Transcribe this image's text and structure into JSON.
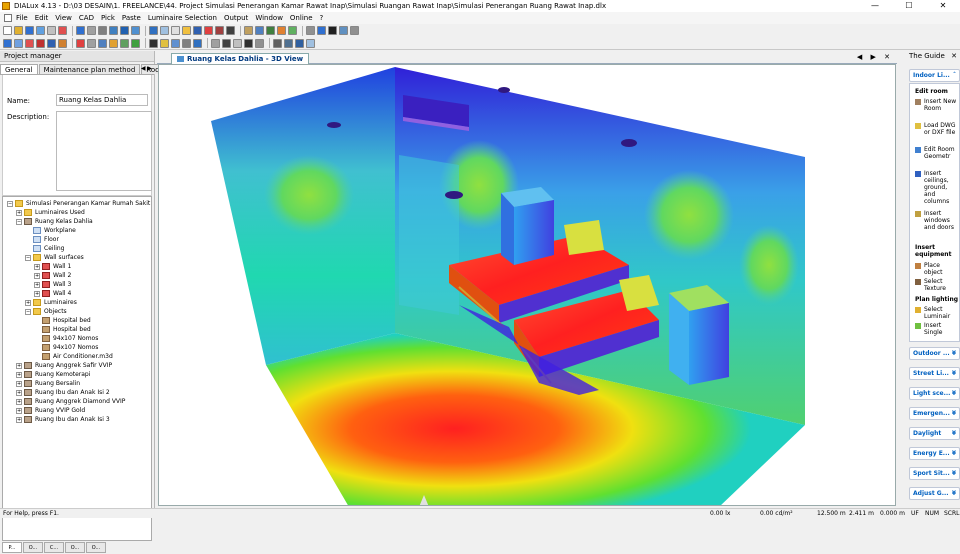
{
  "window": {
    "title": "DIALux 4.13 - D:\\03 DESAIN\\1. FREELANCE\\44. Project Simulasi Penerangan Kamar  Rawat Inap\\Simulasi Ruangan Rawat Inap\\Simulasi Penerangan Ruang Rawat Inap.dlx",
    "min": "—",
    "max": "☐",
    "close": "✕"
  },
  "menu": [
    "File",
    "Edit",
    "View",
    "CAD",
    "Pick",
    "Paste",
    "Luminaire Selection",
    "Output",
    "Window",
    "Online",
    "?"
  ],
  "project_manager": {
    "header": "Project manager",
    "tabs": [
      "General",
      "Maintenance plan method",
      "Roor"
    ],
    "tab_nav": "◀ ▶",
    "name_label": "Name:",
    "name_value": "Ruang Kelas Dahlia",
    "desc_label": "Description:"
  },
  "tree": [
    {
      "label": "Simulasi Penerangan Kamar Rumah Sakit",
      "level": 0,
      "exp": "−",
      "icon": "folder"
    },
    {
      "label": "Luminaires Used",
      "level": 1,
      "exp": "+",
      "icon": "folder"
    },
    {
      "label": "Ruang Kelas Dahlia",
      "level": 1,
      "exp": "−",
      "icon": "room"
    },
    {
      "label": "Workplane",
      "level": 2,
      "exp": "",
      "icon": "surf"
    },
    {
      "label": "Floor",
      "level": 2,
      "exp": "",
      "icon": "surf"
    },
    {
      "label": "Ceiling",
      "level": 2,
      "exp": "",
      "icon": "surf"
    },
    {
      "label": "Wall surfaces",
      "level": 2,
      "exp": "−",
      "icon": "folder"
    },
    {
      "label": "Wall 1",
      "level": 3,
      "exp": "+",
      "icon": "wall"
    },
    {
      "label": "Wall 2",
      "level": 3,
      "exp": "+",
      "icon": "wall"
    },
    {
      "label": "Wall 3",
      "level": 3,
      "exp": "+",
      "icon": "wall"
    },
    {
      "label": "Wall 4",
      "level": 3,
      "exp": "+",
      "icon": "wall"
    },
    {
      "label": "Luminaires",
      "level": 2,
      "exp": "+",
      "icon": "folder"
    },
    {
      "label": "Objects",
      "level": 2,
      "exp": "−",
      "icon": "folder"
    },
    {
      "label": "Hospital bed",
      "level": 3,
      "exp": "",
      "icon": "obj"
    },
    {
      "label": "Hospital bed",
      "level": 3,
      "exp": "",
      "icon": "obj"
    },
    {
      "label": "94x107 Nomos",
      "level": 3,
      "exp": "",
      "icon": "obj"
    },
    {
      "label": "94x107 Nomos",
      "level": 3,
      "exp": "",
      "icon": "obj"
    },
    {
      "label": "Air Conditioner.m3d",
      "level": 3,
      "exp": "",
      "icon": "obj"
    },
    {
      "label": "Ruang Anggrek Safir VVIP",
      "level": 1,
      "exp": "+",
      "icon": "room"
    },
    {
      "label": "Ruang Kemoterapi",
      "level": 1,
      "exp": "+",
      "icon": "room"
    },
    {
      "label": "Ruang Bersalin",
      "level": 1,
      "exp": "+",
      "icon": "room"
    },
    {
      "label": "Ruang Ibu dan Anak Isi 2",
      "level": 1,
      "exp": "+",
      "icon": "room"
    },
    {
      "label": "Ruang Anggrek Diamond VVIP",
      "level": 1,
      "exp": "+",
      "icon": "room"
    },
    {
      "label": "Ruang VVIP Gold",
      "level": 1,
      "exp": "+",
      "icon": "room"
    },
    {
      "label": "Ruang Ibu dan Anak Isi 3",
      "level": 1,
      "exp": "+",
      "icon": "room"
    }
  ],
  "bottom_tabs": [
    "P...",
    "O...",
    "C...",
    "O...",
    "O..."
  ],
  "view": {
    "tab": "Ruang Kelas Dahlia - 3D View",
    "controls": "◀ ▶ ✕"
  },
  "guide": {
    "title": "The Guide",
    "pin": "✕",
    "top_section": "Indoor Li...",
    "groups": [
      {
        "heading": "Edit room",
        "items": [
          "Insert New Room",
          "Load DWG or DXF file",
          "Edit Room Geometr",
          "Insert ceilings, ground, and columns",
          "Insert windows and doors"
        ]
      },
      {
        "heading": "Insert equipment",
        "items": [
          "Place object",
          "Select Texture"
        ]
      },
      {
        "heading": "Plan lighting",
        "items": [
          "Select Luminair",
          "Insert Single"
        ]
      }
    ],
    "sections": [
      "Outdoor ...",
      "Street Li...",
      "Light sce...",
      "Emergen...",
      "Daylight",
      "Energy E...",
      "Sport Sit...",
      "Adjust G..."
    ],
    "chevron": "¥"
  },
  "status": {
    "help": "For Help, press F1.",
    "lx": "0.00 lx",
    "cd": "0.00 cd/m²",
    "x": "12.500 m",
    "y": "2.411 m",
    "z": "0.000 m",
    "uf": "UF",
    "num": "NUM",
    "scrl": "SCRL"
  }
}
